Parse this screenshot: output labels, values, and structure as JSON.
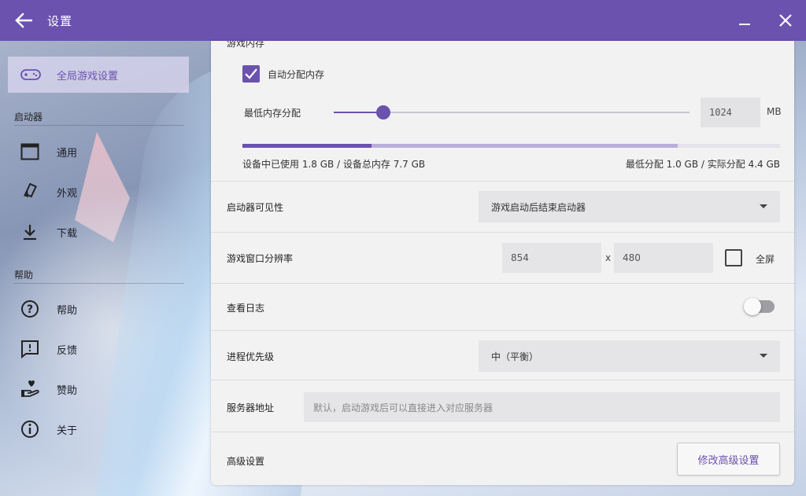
{
  "colors": {
    "accent": "#6b52ae",
    "panel": "#f2f2f3",
    "input": "#e5e5e7"
  },
  "titlebar": {
    "title": "设置",
    "back_icon": "arrow-left-icon",
    "minimize_icon": "minimize-icon",
    "close_icon": "close-icon"
  },
  "sidebar": {
    "active": {
      "label": "全局游戏设置",
      "icon": "gamepad-icon"
    },
    "sections": [
      {
        "title": "启动器",
        "items": [
          {
            "label": "通用",
            "icon": "window-icon"
          },
          {
            "label": "外观",
            "icon": "palette-icon"
          },
          {
            "label": "下载",
            "icon": "download-icon"
          }
        ]
      },
      {
        "title": "帮助",
        "items": [
          {
            "label": "帮助",
            "icon": "help-icon"
          },
          {
            "label": "反馈",
            "icon": "feedback-icon"
          },
          {
            "label": "赞助",
            "icon": "donate-icon"
          },
          {
            "label": "关于",
            "icon": "info-icon"
          }
        ]
      }
    ]
  },
  "memory": {
    "section_label": "游戏内存",
    "auto_label": "自动分配内存",
    "auto_checked": true,
    "min_label": "最低内存分配",
    "slider_fraction": 0.14,
    "value": "1024",
    "unit": "MB",
    "used_fraction": 0.24,
    "allocated_fraction": 0.81,
    "info_left": "设备中已使用 1.8 GB / 设备总内存 7.7 GB",
    "info_right": "最低分配 1.0 GB / 实际分配 4.4 GB"
  },
  "settings": {
    "visibility": {
      "label": "启动器可见性",
      "value": "游戏启动后结束启动器"
    },
    "resolution": {
      "label": "游戏窗口分辨率",
      "width": "854",
      "x": "x",
      "height": "480",
      "fullscreen_label": "全屏",
      "fullscreen": false
    },
    "log": {
      "label": "查看日志",
      "enabled": false
    },
    "priority": {
      "label": "进程优先级",
      "value": "中（平衡）"
    },
    "server": {
      "label": "服务器地址",
      "placeholder": "默认，启动游戏后可以直接进入对应服务器"
    },
    "advanced": {
      "label": "高级设置",
      "button": "修改高级设置"
    }
  }
}
